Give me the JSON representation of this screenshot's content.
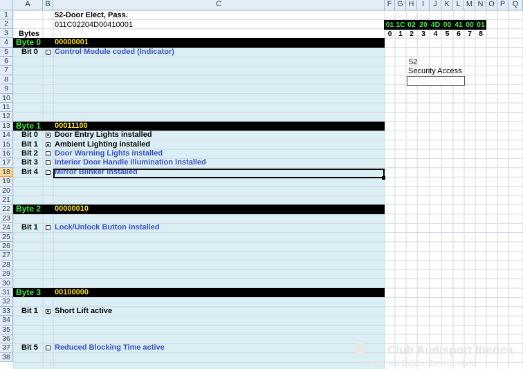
{
  "header_title": "52-Door Elect, Pass.",
  "coding_string": "011C02204D00410001",
  "bytes_label": "Bytes",
  "columns": [
    "A",
    "B",
    "C",
    "F",
    "G",
    "H",
    "I",
    "J",
    "K",
    "L",
    "M",
    "N",
    "O",
    "P",
    "Q"
  ],
  "rows": [
    "1",
    "2",
    "3",
    "4",
    "5",
    "6",
    "7",
    "8",
    "9",
    "10",
    "11",
    "12",
    "13",
    "14",
    "15",
    "16",
    "17",
    "18",
    "19",
    "20",
    "21",
    "22",
    "23",
    "24",
    "25",
    "26",
    "27",
    "28",
    "29",
    "30",
    "31",
    "32",
    "33",
    "34",
    "35",
    "36",
    "37",
    "38"
  ],
  "selected_row": "18",
  "hex_bytes": [
    "01",
    "1C",
    "02",
    "20",
    "4D",
    "00",
    "41",
    "00",
    "01"
  ],
  "byte_indices": [
    "0",
    "1",
    "2",
    "3",
    "4",
    "5",
    "6",
    "7",
    "8"
  ],
  "security": {
    "code": "52",
    "label": "Security Access",
    "input_value": ""
  },
  "byte0": {
    "label": "Byte 0",
    "value": "00000001",
    "bits": [
      {
        "bit": "Bit 0",
        "label": "Control Module coded (Indicator)",
        "checked": false
      }
    ]
  },
  "byte1": {
    "label": "Byte 1",
    "value": "00011100",
    "bits": [
      {
        "bit": "Bit 0",
        "label": "Door Entry Lights installed",
        "checked": true
      },
      {
        "bit": "Bit 1",
        "label": "Ambient Lighting installed",
        "checked": true
      },
      {
        "bit": "Bit 2",
        "label": "Door Warning Lights installed",
        "checked": false
      },
      {
        "bit": "Bit 3",
        "label": "Interior Door Handle Illumination installed",
        "checked": false
      },
      {
        "bit": "Bit 4",
        "label": "Mirror Blinker installed",
        "checked": false
      }
    ]
  },
  "byte2": {
    "label": "Byte 2",
    "value": "00000010",
    "bits": [
      {
        "bit": "Bit 1",
        "label": "Lock/Unlock Button installed",
        "checked": false
      }
    ]
  },
  "byte3": {
    "label": "Byte 3",
    "value": "00100000",
    "bits": [
      {
        "bit": "Bit 1",
        "label": "Short Lift active",
        "checked": true
      },
      {
        "bit": "Bit 5",
        "label": "Reduced Blocking Time active",
        "checked": false
      }
    ]
  },
  "watermark": {
    "line1": "Club Audisport Iberica",
    "line2": "www.audisport-iberica.com"
  },
  "colors": {
    "panel": "#daeef3",
    "grid": "#d0d7e5",
    "header": "#e4ecf7",
    "byte_bar": "#000000",
    "byte_label": "#3df03a",
    "byte_value": "#ffdf1f",
    "link_text": "#3a50c4"
  }
}
